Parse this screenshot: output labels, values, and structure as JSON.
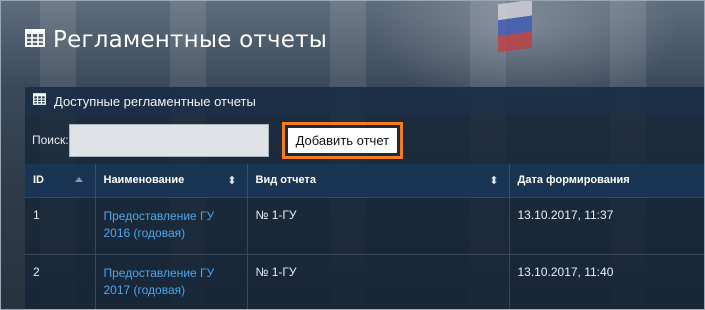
{
  "page": {
    "title": "Регламентные отчеты"
  },
  "panel": {
    "title": "Доступные регламентные отчеты"
  },
  "toolbar": {
    "search_label": "Поиск:",
    "search_value": "",
    "add_button_label": "Добавить отчет",
    "highlight_color": "#f47c20"
  },
  "table": {
    "columns": [
      {
        "label": "ID",
        "sort": "asc"
      },
      {
        "label": "Наименование",
        "sort": "both"
      },
      {
        "label": "Вид отчета",
        "sort": "both"
      },
      {
        "label": "Дата формирования",
        "sort": "none"
      }
    ],
    "rows": [
      {
        "id": "1",
        "name": "Предоставление ГУ 2016 (годовая)",
        "type": "№ 1-ГУ",
        "date": "13.10.2017, 11:37"
      },
      {
        "id": "2",
        "name": "Предоставление ГУ 2017 (годовая)",
        "type": "№ 1-ГУ",
        "date": "13.10.2017, 11:40"
      }
    ]
  },
  "icons": {
    "title_icon": "table-grid-icon",
    "panel_icon": "table-grid-icon",
    "sort_asc_icon": "sort-asc-icon",
    "sort_both_icon": "sort-both-icon"
  }
}
